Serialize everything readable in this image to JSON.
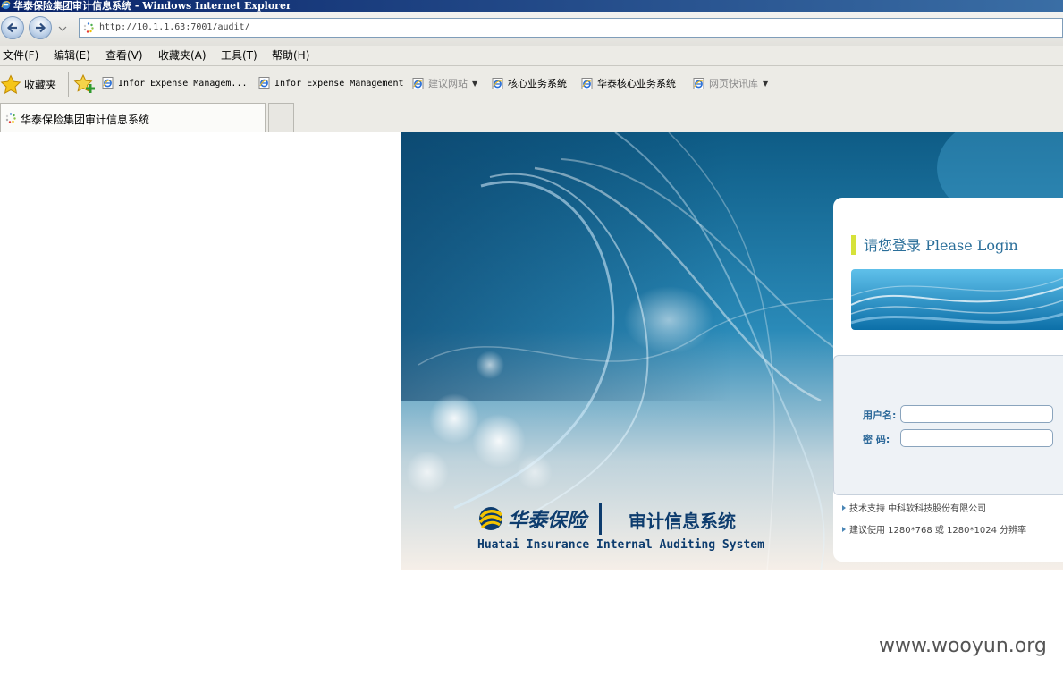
{
  "window": {
    "title": "华泰保险集团审计信息系统 - Windows Internet Explorer"
  },
  "address_bar": {
    "url": "http://10.1.1.63:7001/audit/"
  },
  "menu": {
    "items": [
      "文件(F)",
      "编辑(E)",
      "查看(V)",
      "收藏夹(A)",
      "工具(T)",
      "帮助(H)"
    ]
  },
  "favorites_bar": {
    "label": "收藏夹",
    "items": [
      {
        "label": "Infor Expense Managem...",
        "icon": "ie-page-icon"
      },
      {
        "label": "Infor Expense Management",
        "icon": "ie-page-icon"
      },
      {
        "label": "建议网站",
        "icon": "ie-page-icon",
        "dropdown": true
      },
      {
        "label": "核心业务系统",
        "icon": "ie-page-icon"
      },
      {
        "label": "华泰核心业务系统",
        "icon": "ie-page-icon"
      },
      {
        "label": "网页快讯库",
        "icon": "ie-page-icon",
        "dropdown": true
      }
    ]
  },
  "tab": {
    "title": "华泰保险集团审计信息系统"
  },
  "login": {
    "title": "请您登录 Please Login",
    "username_label": "用户名:",
    "password_label": "密  码:",
    "username_value": "",
    "password_value": "",
    "support_note": "技术支持 中科软科技股份有限公司",
    "resolution_note": "建议使用 1280*768 或 1280*1024 分辨率"
  },
  "branding": {
    "company": "华泰保险",
    "system_name": "审计信息系统",
    "english_name": "Huatai Insurance Internal Auditing System"
  },
  "watermark": "www.wooyun.org",
  "colors": {
    "title_bar": "#0a246a",
    "brand_navy": "#0d3c6e",
    "login_accent": "#2b6f9a",
    "title_marker": "#d6e23a"
  }
}
